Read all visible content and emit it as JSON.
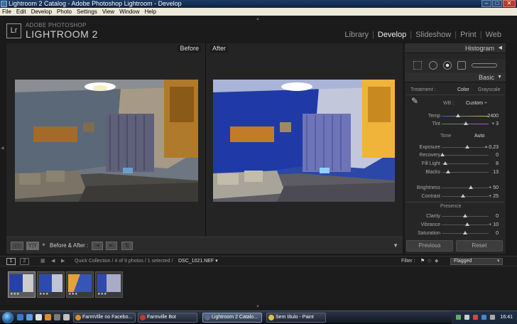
{
  "window": {
    "title": "Lightroom 2 Catalog - Adobe Photoshop Lightroom - Develop"
  },
  "menu": [
    "File",
    "Edit",
    "Develop",
    "Photo",
    "Settings",
    "View",
    "Window",
    "Help"
  ],
  "identity": {
    "logo": "Lr",
    "small": "ADOBE PHOTOSHOP",
    "big": "LIGHTROOM 2"
  },
  "modules": [
    "Library",
    "Develop",
    "Slideshow",
    "Print",
    "Web"
  ],
  "active_module": "Develop",
  "view": {
    "before_label": "Before",
    "after_label": "After"
  },
  "toolbar": {
    "ba_label": "Before & After :",
    "ba_mode_label": "Y|Y"
  },
  "panels": {
    "histogram": "Histogram",
    "basic": "Basic",
    "treatment_label": "Treatment :",
    "treatment_color": "Color",
    "treatment_gray": "Grayscale",
    "wb_label": "WB :",
    "wb_value": "Custom ÷",
    "tone_label": "Tone",
    "auto_label": "Auto",
    "presence_label": "Presence",
    "sliders": [
      {
        "label": "Temp",
        "value": "2400",
        "pos": 0.35
      },
      {
        "label": "Tint",
        "value": "+ 3",
        "pos": 0.52
      },
      {
        "label": "Exposure",
        "value": "+ 0,23",
        "pos": 0.55
      },
      {
        "label": "Recovery",
        "value": "0",
        "pos": 0.02
      },
      {
        "label": "Fill Light",
        "value": "8",
        "pos": 0.08
      },
      {
        "label": "Blacks",
        "value": "13",
        "pos": 0.13
      },
      {
        "label": "Brightness",
        "value": "+ 50",
        "pos": 0.62
      },
      {
        "label": "Contrast",
        "value": "+ 25",
        "pos": 0.45
      },
      {
        "label": "Clarity",
        "value": "0",
        "pos": 0.5
      },
      {
        "label": "Vibrance",
        "value": "+ 10",
        "pos": 0.55
      },
      {
        "label": "Saturation",
        "value": "0",
        "pos": 0.5
      }
    ],
    "previous": "Previous",
    "reset": "Reset"
  },
  "filmbar": {
    "page1": "1",
    "page2": "2",
    "source": "Quick Collection / 4 of 9 photos / 1 selected /",
    "filename": "DSC_1021.NEF ▾",
    "filter_label": "Filter :",
    "filter_value": "Flagged"
  },
  "thumbs": [
    {
      "stars": "★★★",
      "selected": true
    },
    {
      "stars": "★★★",
      "selected": false
    },
    {
      "stars": "★★★",
      "selected": false
    },
    {
      "stars": "★★★",
      "selected": false
    }
  ],
  "taskbar": {
    "items": [
      "FarmVille no Facebo...",
      "Farmville Bot",
      "Lightroom 2 Catalo...",
      "Sem título - Paint"
    ],
    "clock": "16:41"
  },
  "colors": {
    "accent_module": "#eeeeee",
    "wall_before": "#5c6e7e",
    "wall_after": "#1d3aa6"
  }
}
